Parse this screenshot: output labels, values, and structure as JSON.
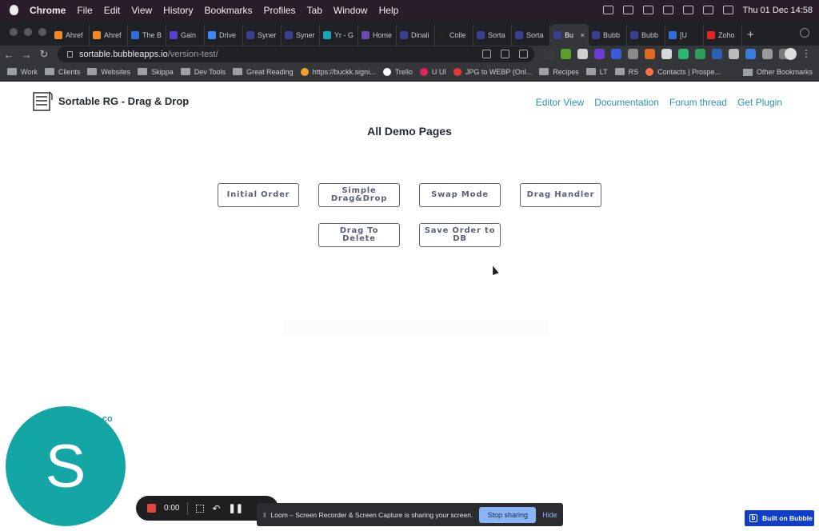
{
  "menubar": {
    "items": [
      "Chrome",
      "File",
      "Edit",
      "View",
      "History",
      "Bookmarks",
      "Profiles",
      "Tab",
      "Window",
      "Help"
    ],
    "datetime": "Thu 01 Dec  14:58"
  },
  "tabs": [
    {
      "label": "Ahref",
      "color": "#f08a24"
    },
    {
      "label": "Ahref",
      "color": "#f08a24"
    },
    {
      "label": "The B",
      "color": "#2f6fd6"
    },
    {
      "label": "Gain",
      "color": "#5b3fd1"
    },
    {
      "label": "Drive",
      "color": "#4285f4"
    },
    {
      "label": "Syner",
      "color": "#3a3f8f"
    },
    {
      "label": "Syner",
      "color": "#3a3f8f"
    },
    {
      "label": "Yr - G",
      "color": "#1aa6b7"
    },
    {
      "label": "Home",
      "color": "#6d4bb0"
    },
    {
      "label": "Dinali",
      "color": "#3a3f8f"
    },
    {
      "label": "Colle",
      "color": "#222222"
    },
    {
      "label": "Sorta",
      "color": "#3a3f8f"
    },
    {
      "label": "Sorta",
      "color": "#3a3f8f"
    },
    {
      "label": "Bu",
      "color": "#3a3f8f",
      "active": true
    },
    {
      "label": "Bubb",
      "color": "#3a3f8f"
    },
    {
      "label": "Bubb",
      "color": "#3a3f8f"
    },
    {
      "label": "[U",
      "color": "#2f6fd6"
    },
    {
      "label": "Zoho",
      "color": "#e42527"
    }
  ],
  "new_tab_label": "+",
  "address": {
    "host": "sortable.bubbleapps.io",
    "path": "/version-test/"
  },
  "bookmarks": [
    {
      "label": "Work",
      "kind": "folder"
    },
    {
      "label": "Clients",
      "kind": "folder"
    },
    {
      "label": "Websites",
      "kind": "folder"
    },
    {
      "label": "Skippa",
      "kind": "folder"
    },
    {
      "label": "Dev Tools",
      "kind": "folder"
    },
    {
      "label": "Great Reading",
      "kind": "folder"
    },
    {
      "label": "https://buckk.signi...",
      "kind": "site",
      "color": "#f0a030"
    },
    {
      "label": "Trello",
      "kind": "site",
      "color": "#ffffff"
    },
    {
      "label": "U UI",
      "kind": "site",
      "color": "#e0245e"
    },
    {
      "label": "JPG to WEBP (Onl...",
      "kind": "site",
      "color": "#e53935"
    },
    {
      "label": "Recipes",
      "kind": "folder"
    },
    {
      "label": "LT",
      "kind": "folder"
    },
    {
      "label": "RS",
      "kind": "folder"
    },
    {
      "label": "Contacts | Prospe...",
      "kind": "site",
      "color": "#ff7043"
    }
  ],
  "other_bookmarks": "Other Bookmarks",
  "site": {
    "brand": "Sortable RG - Drag & Drop",
    "nav": [
      "Editor View",
      "Documentation",
      "Forum thread",
      "Get Plugin"
    ],
    "heading": "All Demo Pages",
    "buttons": [
      "Initial Order",
      "Simple Drag&Drop",
      "Swap Mode",
      "Drag Handler",
      "Drag To Delete",
      "Save Order to DB"
    ],
    "partial_text": "de.co"
  },
  "avatar_letter": "S",
  "recorder": {
    "time": "0:00"
  },
  "share_bar": {
    "message": "Loom – Screen Recorder & Screen Capture is sharing your screen.",
    "stop": "Stop sharing",
    "hide": "Hide"
  },
  "built_badge": "Built on Bubble",
  "colors": {
    "accent_link": "#2e93b1",
    "avatar": "#13a6a4",
    "badge": "#0f3ec9"
  }
}
